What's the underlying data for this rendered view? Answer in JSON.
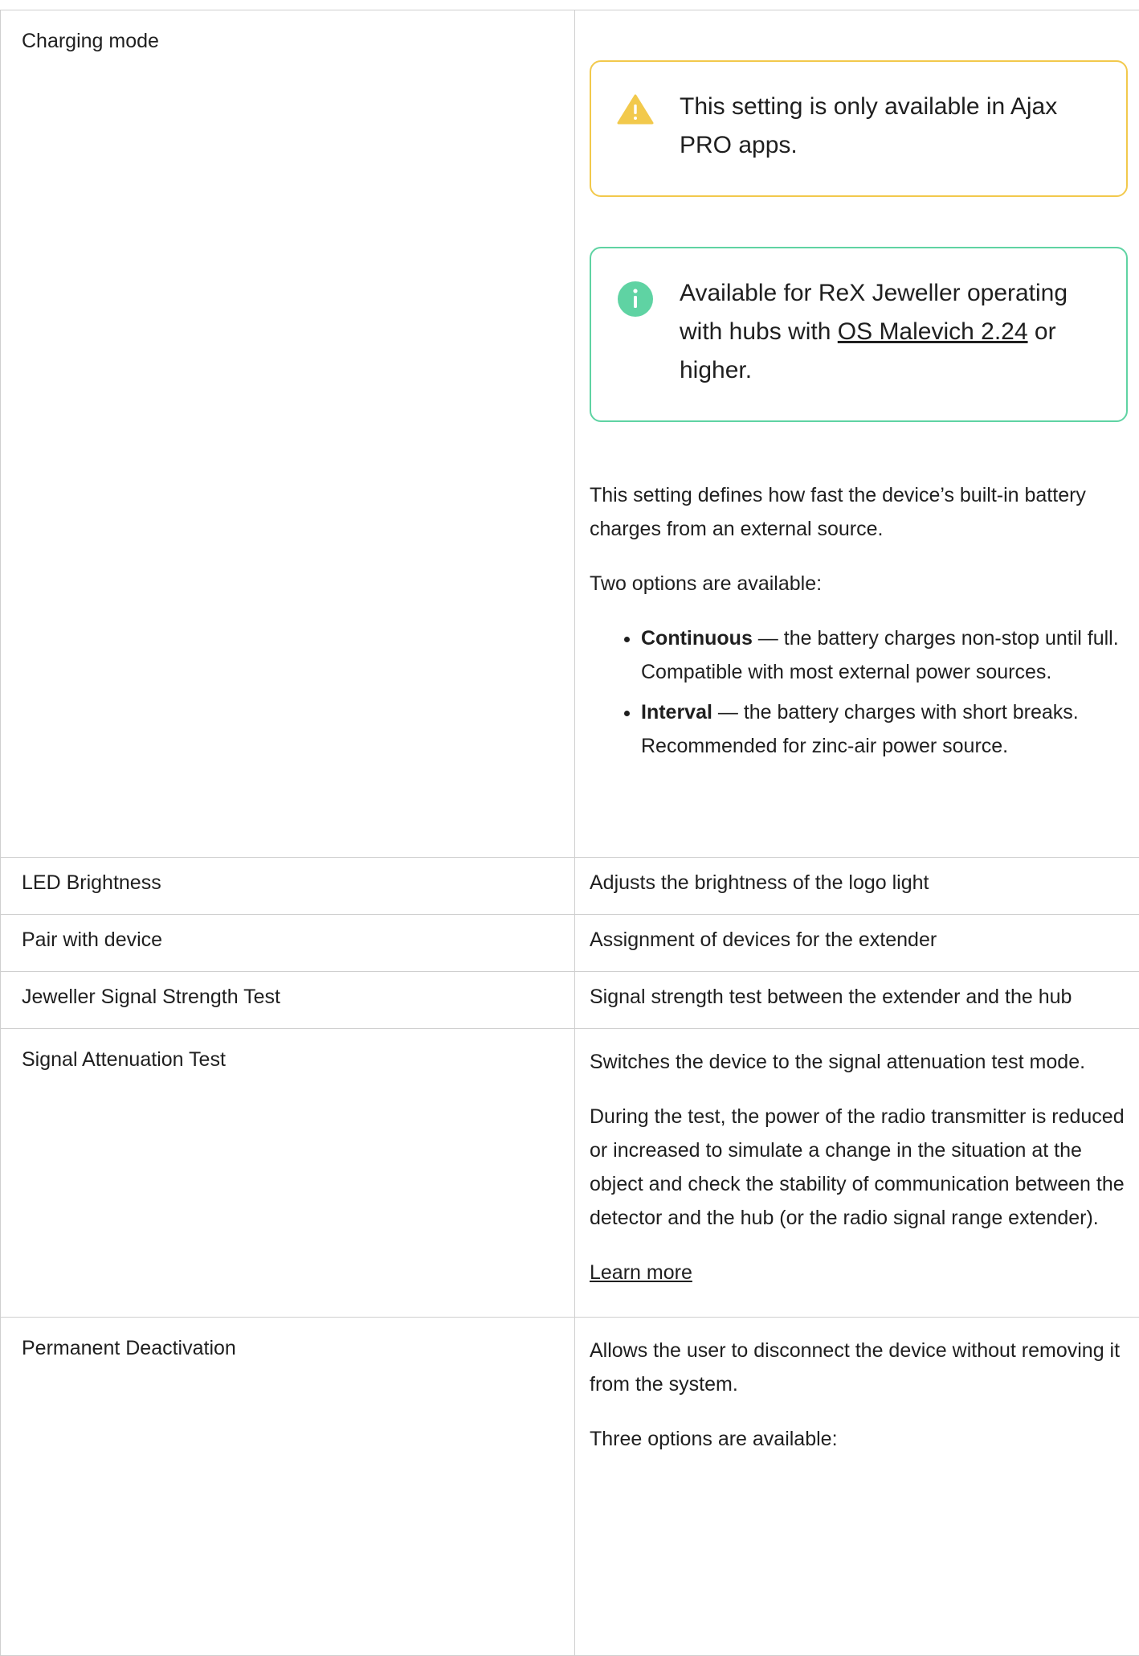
{
  "rows": [
    {
      "label": "Charging mode",
      "warning": "This setting is only available in Ajax PRO apps.",
      "info": {
        "prefix": "Available for ReX Jeweller operating with hubs with ",
        "link": "OS Malevich 2.24",
        "suffix": " or higher."
      },
      "description": "This setting defines how fast the device’s built-in battery charges from an external source.",
      "options_intro": "Two options are available:",
      "options": [
        {
          "term": "Continuous",
          "text": " — the battery charges non-stop until full. Compatible with most external power sources."
        },
        {
          "term": "Interval",
          "text": " — the battery charges with short breaks. Recommended for zinc-air power source."
        }
      ]
    },
    {
      "label": "LED Brightness",
      "description": "Adjusts the brightness of the logo light"
    },
    {
      "label": "Pair with device",
      "description": "Assignment of devices for the extender"
    },
    {
      "label": "Jeweller Signal Strength Test",
      "description": "Signal strength test between the extender and the hub"
    },
    {
      "label": "Signal Attenuation Test",
      "description": "Switches the device to the signal attenuation test mode.",
      "details": "During the test, the power of the radio transmitter is reduced or increased to simulate a change in the situation at the object and check the stability of communication between the detector and the hub (or the radio signal range extender).",
      "link": "Learn more"
    },
    {
      "label": "Permanent Deactivation",
      "description": "Allows the user to disconnect the device without removing it from the system.",
      "options_intro": "Three options are available:"
    }
  ],
  "colors": {
    "warning": "#f2c94c",
    "info": "#5fd3a3",
    "border": "#cfcfcf"
  },
  "icons": {
    "warning": "warning-triangle-icon",
    "info": "info-circle-icon"
  }
}
